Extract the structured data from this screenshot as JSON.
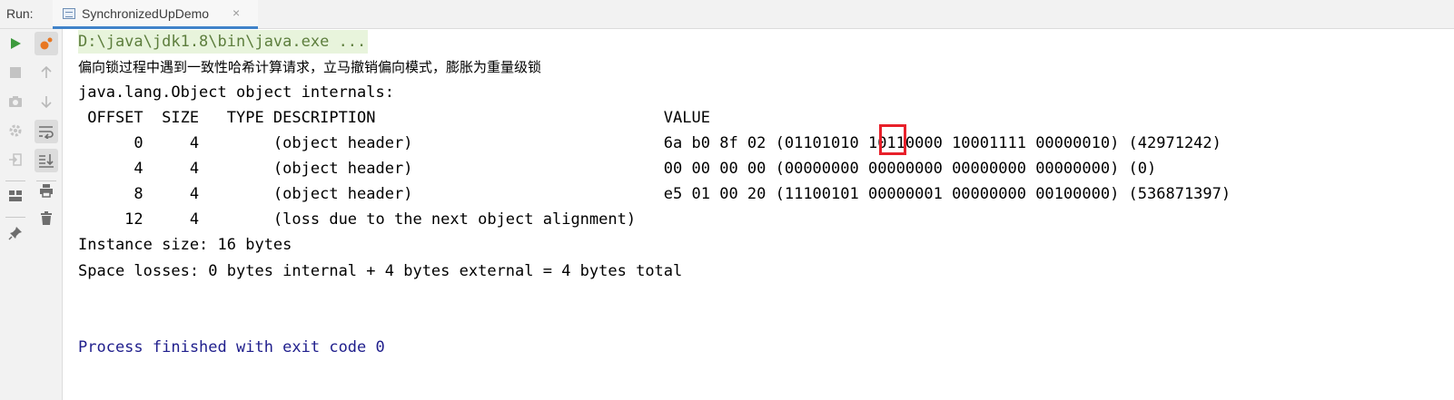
{
  "run_bar": {
    "label": "Run:",
    "tab_title": "SynchronizedUpDemo",
    "tab_close": "×"
  },
  "toolbar": {
    "left": [
      {
        "name": "run-icon",
        "glyph": "▶",
        "color": "#3d9a3d",
        "enabled": true
      },
      {
        "name": "stop-icon",
        "glyph": "■",
        "color": "#b9b9b9",
        "enabled": false
      },
      {
        "name": "camera-icon",
        "glyph": "📷",
        "color": "#b9b9b9",
        "enabled": false
      },
      {
        "name": "gear-icon",
        "glyph": "⚙",
        "color": "#b9b9b9",
        "enabled": false
      },
      {
        "name": "exit-icon",
        "glyph": "⇥",
        "color": "#b9b9b9",
        "enabled": false
      },
      {
        "name": "layout-icon",
        "glyph": "▦",
        "color": "#6e6e6e",
        "enabled": true
      },
      {
        "name": "pin-icon",
        "glyph": "📌",
        "color": "#6e6e6e",
        "enabled": true
      }
    ],
    "right": [
      {
        "name": "debug-icon",
        "color": "#e87722",
        "enabled": true
      },
      {
        "name": "arrow-up-icon",
        "glyph": "↑",
        "color": "#b9b9b9",
        "enabled": false
      },
      {
        "name": "arrow-down-icon",
        "glyph": "↓",
        "color": "#b9b9b9",
        "enabled": false
      },
      {
        "name": "soft-wrap-icon",
        "glyph": "↵",
        "color": "#6e6e6e",
        "enabled": true
      },
      {
        "name": "scroll-to-end-icon",
        "glyph": "⤓",
        "color": "#6e6e6e",
        "enabled": true
      },
      {
        "name": "print-icon",
        "glyph": "⎙",
        "color": "#6e6e6e",
        "enabled": true
      },
      {
        "name": "trash-icon",
        "glyph": "🗑",
        "color": "#6e6e6e",
        "enabled": true
      }
    ]
  },
  "console": {
    "command": "D:\\java\\jdk1.8\\bin\\java.exe ...",
    "message": "偏向锁过程中遇到一致性哈希计算请求，立马撤销偏向模式，膨胀为重量级锁",
    "header": "java.lang.Object object internals:",
    "table_header": " OFFSET  SIZE   TYPE DESCRIPTION                               VALUE",
    "rows": [
      "      0     4        (object header)                           6a b0 8f 02 (01101010 10110000 10001111 00000010) (42971242)",
      "      4     4        (object header)                           00 00 00 00 (00000000 00000000 00000000 00000000) (0)",
      "      8     4        (object header)                           e5 01 00 20 (11100101 00000001 00000000 00100000) (536871397)",
      "     12     4        (loss due to the next object alignment)"
    ],
    "instance_size": "Instance size: 16 bytes",
    "space_losses": "Space losses: 0 bytes internal + 4 bytes external = 4 bytes total",
    "finished": "Process finished with exit code 0"
  },
  "colors": {
    "command_text": "#5d7e3d",
    "command_bg": "#e8f4dc",
    "finished_text": "#1f1e8c",
    "highlight": "#e8202a",
    "tab_underline": "#4083c9"
  }
}
